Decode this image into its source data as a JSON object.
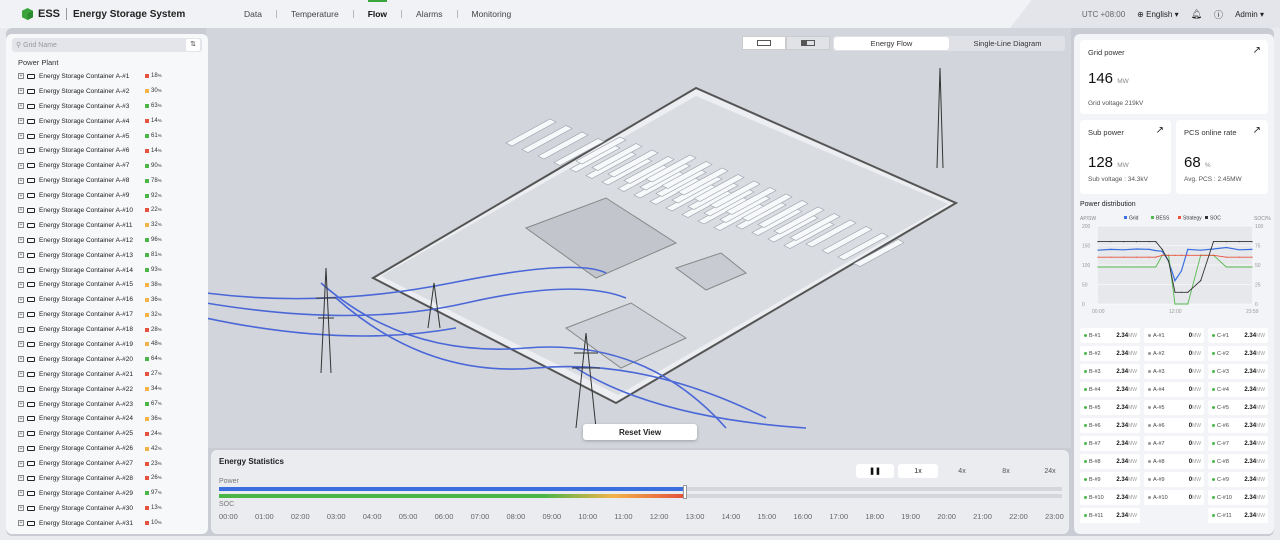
{
  "app": {
    "name": "ESS",
    "title": "Energy Storage System"
  },
  "nav": [
    "Data",
    "Temperature",
    "Flow",
    "Alarms",
    "Monitoring"
  ],
  "header": {
    "utc": "UTC +08:00",
    "language": "English",
    "user": "Admin"
  },
  "sidebar": {
    "search_placeholder": "Grid Name",
    "root": "Power Plant",
    "items": [
      {
        "name": "Energy Storage Container A-#1",
        "pct": "18",
        "color": "#e5533c"
      },
      {
        "name": "Energy Storage Container A-#2",
        "pct": "30",
        "color": "#f2b34a"
      },
      {
        "name": "Energy Storage Container A-#3",
        "pct": "63",
        "color": "#4cb548"
      },
      {
        "name": "Energy Storage Container A-#4",
        "pct": "14",
        "color": "#e5533c"
      },
      {
        "name": "Energy Storage Container A-#5",
        "pct": "61",
        "color": "#4cb548"
      },
      {
        "name": "Energy Storage Container A-#6",
        "pct": "14",
        "color": "#e5533c"
      },
      {
        "name": "Energy Storage Container A-#7",
        "pct": "90",
        "color": "#4cb548"
      },
      {
        "name": "Energy Storage Container A-#8",
        "pct": "78",
        "color": "#4cb548"
      },
      {
        "name": "Energy Storage Container A-#9",
        "pct": "92",
        "color": "#4cb548"
      },
      {
        "name": "Energy Storage Container A-#10",
        "pct": "22",
        "color": "#e5533c"
      },
      {
        "name": "Energy Storage Container A-#11",
        "pct": "32",
        "color": "#f2b34a"
      },
      {
        "name": "Energy Storage Container A-#12",
        "pct": "96",
        "color": "#4cb548"
      },
      {
        "name": "Energy Storage Container A-#13",
        "pct": "81",
        "color": "#4cb548"
      },
      {
        "name": "Energy Storage Container A-#14",
        "pct": "93",
        "color": "#4cb548"
      },
      {
        "name": "Energy Storage Container A-#15",
        "pct": "38",
        "color": "#f2b34a"
      },
      {
        "name": "Energy Storage Container A-#16",
        "pct": "36",
        "color": "#f2b34a"
      },
      {
        "name": "Energy Storage Container A-#17",
        "pct": "32",
        "color": "#f2b34a"
      },
      {
        "name": "Energy Storage Container A-#18",
        "pct": "28",
        "color": "#e5533c"
      },
      {
        "name": "Energy Storage Container A-#19",
        "pct": "48",
        "color": "#f2b34a"
      },
      {
        "name": "Energy Storage Container A-#20",
        "pct": "64",
        "color": "#4cb548"
      },
      {
        "name": "Energy Storage Container A-#21",
        "pct": "27",
        "color": "#e5533c"
      },
      {
        "name": "Energy Storage Container A-#22",
        "pct": "34",
        "color": "#f2b34a"
      },
      {
        "name": "Energy Storage Container A-#23",
        "pct": "67",
        "color": "#4cb548"
      },
      {
        "name": "Energy Storage Container A-#24",
        "pct": "36",
        "color": "#f2b34a"
      },
      {
        "name": "Energy Storage Container A-#25",
        "pct": "24",
        "color": "#e5533c"
      },
      {
        "name": "Energy Storage Container A-#26",
        "pct": "42",
        "color": "#f2b34a"
      },
      {
        "name": "Energy Storage Container A-#27",
        "pct": "23",
        "color": "#e5533c"
      },
      {
        "name": "Energy Storage Container A-#28",
        "pct": "26",
        "color": "#e5533c"
      },
      {
        "name": "Energy Storage Container A-#29",
        "pct": "97",
        "color": "#4cb548"
      },
      {
        "name": "Energy Storage Container A-#30",
        "pct": "13",
        "color": "#e5533c"
      },
      {
        "name": "Energy Storage Container A-#31",
        "pct": "10",
        "color": "#e5533c"
      }
    ]
  },
  "view_tabs": [
    "Energy Flow",
    "Single-Line Diagram"
  ],
  "reset_view": "Reset View",
  "stats": {
    "title": "Energy Statistics",
    "power_label": "Power",
    "soc_label": "SOC",
    "speeds": [
      "1x",
      "4x",
      "8x",
      "24x"
    ],
    "active_speed": "1x",
    "progress": 0.55,
    "hours": [
      "00:00",
      "01:00",
      "02:00",
      "03:00",
      "04:00",
      "05:00",
      "06:00",
      "07:00",
      "08:00",
      "09:00",
      "10:00",
      "11:00",
      "12:00",
      "13:00",
      "14:00",
      "15:00",
      "16:00",
      "17:00",
      "18:00",
      "19:00",
      "20:00",
      "21:00",
      "22:00",
      "23:00"
    ]
  },
  "metrics": {
    "grid_power": {
      "label": "Grid power",
      "value": "146",
      "unit": "MW",
      "sub": "Grid voltage 219kV"
    },
    "sub_power": {
      "label": "Sub power",
      "value": "128",
      "unit": "MW",
      "sub": "Sub voltage : 34.3kV"
    },
    "pcs": {
      "label": "PCS online rate",
      "value": "68",
      "unit": "%",
      "sub": "Avg. PCS : 2.45MW"
    }
  },
  "chart_data": {
    "type": "line",
    "title": "Power distribution",
    "ylabel": "AP/SW",
    "y2label": "SOC/%",
    "ylim": [
      0,
      200
    ],
    "y2lim": [
      0,
      100
    ],
    "yticks": [
      "200",
      "150",
      "100",
      "50",
      "0"
    ],
    "y2ticks": [
      "100",
      "75",
      "50",
      "25",
      "0"
    ],
    "xticks": [
      "00:00",
      "12:00",
      "23:59"
    ],
    "legend": [
      {
        "name": "Grid",
        "color": "#3b6fe0"
      },
      {
        "name": "BESS",
        "color": "#56b94f"
      },
      {
        "name": "Strategy",
        "color": "#e8533c"
      },
      {
        "name": "SOC",
        "color": "#333333"
      }
    ],
    "x": [
      0,
      2,
      4,
      6,
      8,
      9,
      10,
      11,
      12,
      13,
      14,
      16,
      18,
      20,
      22,
      24
    ],
    "series": [
      {
        "name": "Grid",
        "values": [
          138,
          140,
          139,
          141,
          140,
          137,
          135,
          110,
          60,
          85,
          140,
          138,
          141,
          145,
          139,
          140
        ]
      },
      {
        "name": "BESS",
        "values": [
          95,
          95,
          95,
          95,
          95,
          95,
          125,
          125,
          0,
          0,
          0,
          125,
          125,
          95,
          95,
          95
        ]
      },
      {
        "name": "Strategy",
        "values": [
          120,
          120,
          120,
          120,
          120,
          120,
          125,
          125,
          125,
          125,
          125,
          125,
          125,
          120,
          120,
          120
        ]
      },
      {
        "name": "SOC",
        "values": [
          80,
          80,
          80,
          80,
          80,
          80,
          70,
          55,
          15,
          15,
          15,
          30,
          80,
          80,
          80,
          80
        ]
      }
    ]
  },
  "groups": {
    "B": [
      [
        "B-#1",
        "2.34"
      ],
      [
        "B-#2",
        "2.34"
      ],
      [
        "B-#3",
        "2.34"
      ],
      [
        "B-#4",
        "2.34"
      ],
      [
        "B-#5",
        "2.34"
      ],
      [
        "B-#6",
        "2.34"
      ],
      [
        "B-#7",
        "2.34"
      ],
      [
        "B-#8",
        "2.34"
      ],
      [
        "B-#9",
        "2.34"
      ],
      [
        "B-#10",
        "2.34"
      ],
      [
        "B-#11",
        "2.34"
      ]
    ],
    "A": [
      [
        "A-#1",
        "0"
      ],
      [
        "A-#2",
        "0"
      ],
      [
        "A-#3",
        "0"
      ],
      [
        "A-#4",
        "0"
      ],
      [
        "A-#5",
        "0"
      ],
      [
        "A-#6",
        "0"
      ],
      [
        "A-#7",
        "0"
      ],
      [
        "A-#8",
        "0"
      ],
      [
        "A-#9",
        "0"
      ],
      [
        "A-#10",
        "0"
      ]
    ],
    "C": [
      [
        "C-#1",
        "2.34"
      ],
      [
        "C-#2",
        "2.34"
      ],
      [
        "C-#3",
        "2.34"
      ],
      [
        "C-#4",
        "2.34"
      ],
      [
        "C-#5",
        "2.34"
      ],
      [
        "C-#6",
        "2.34"
      ],
      [
        "C-#7",
        "2.34"
      ],
      [
        "C-#8",
        "2.34"
      ],
      [
        "C-#9",
        "2.34"
      ],
      [
        "C-#10",
        "2.34"
      ],
      [
        "C-#11",
        "2.34"
      ]
    ],
    "unit": "MW"
  }
}
